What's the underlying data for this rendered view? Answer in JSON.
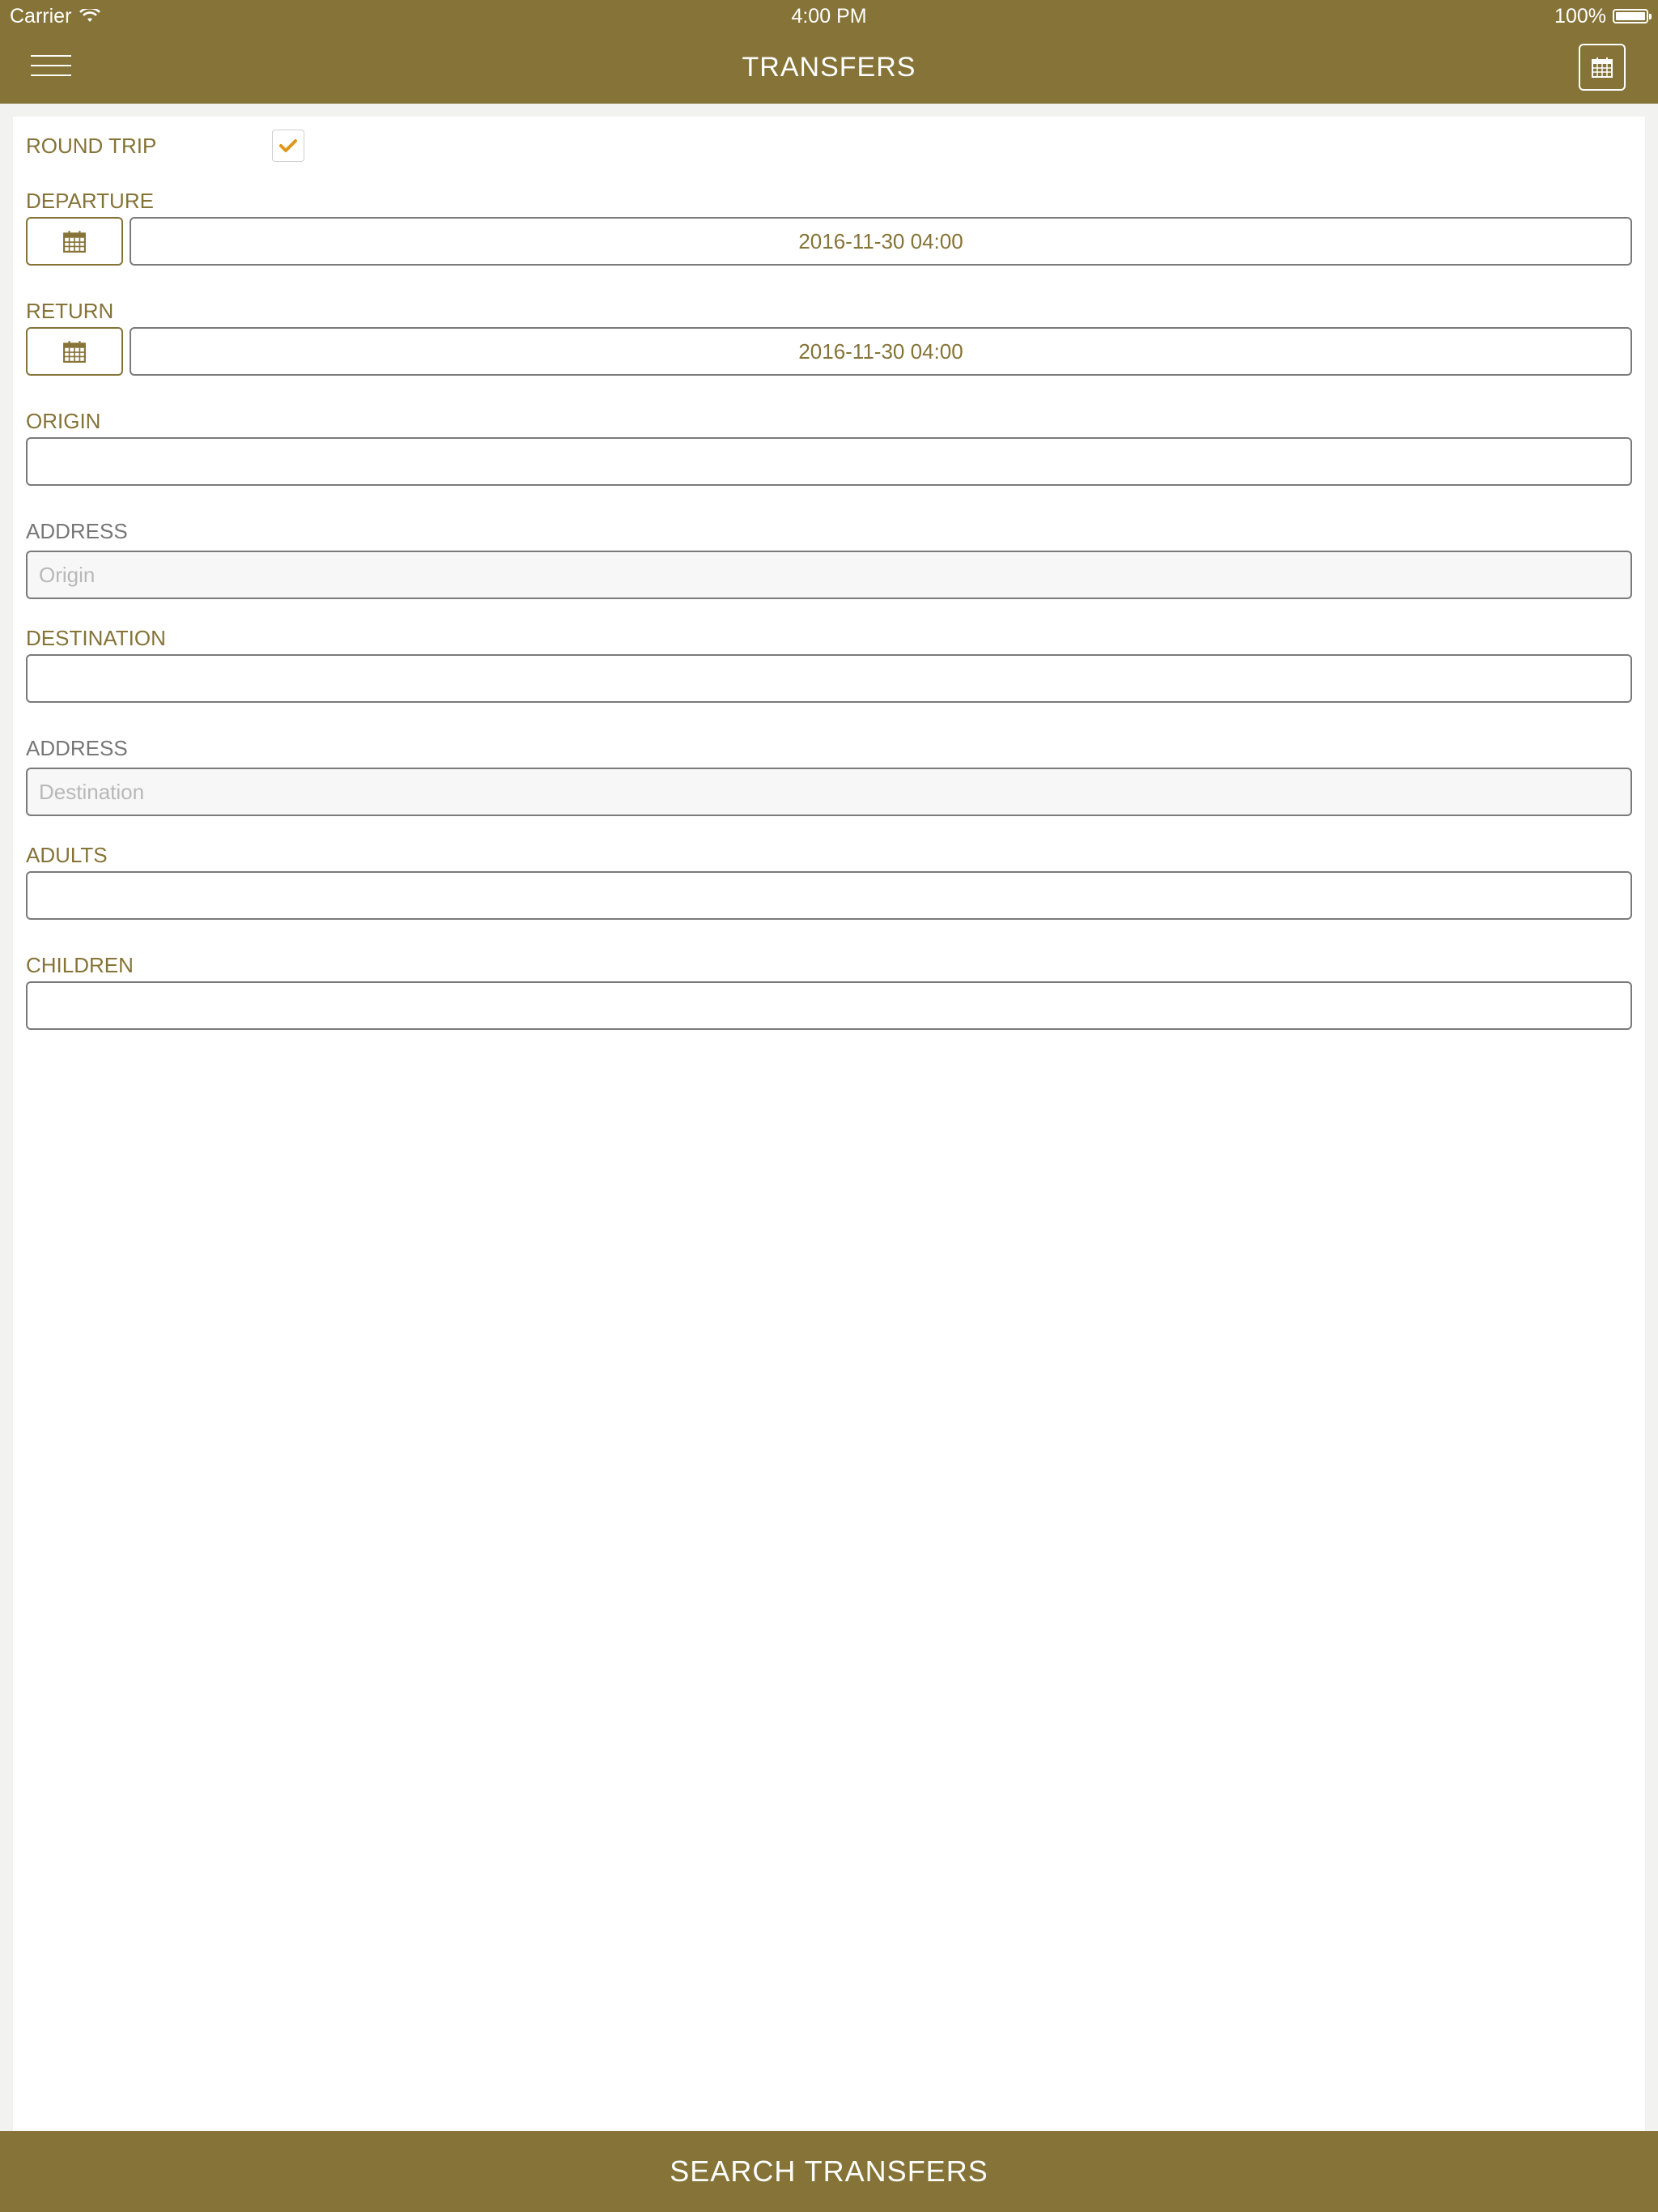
{
  "status_bar": {
    "carrier": "Carrier",
    "time": "4:00 PM",
    "battery": "100%"
  },
  "header": {
    "title": "TRANSFERS",
    "menu_icon": "hamburger-menu-icon",
    "calendar_icon": "calendar-icon"
  },
  "form": {
    "round_trip": {
      "label": "ROUND TRIP",
      "checked": true
    },
    "departure": {
      "label": "DEPARTURE",
      "value": "2016-11-30 04:00"
    },
    "return": {
      "label": "RETURN",
      "value": "2016-11-30 04:00"
    },
    "origin": {
      "label": "ORIGIN",
      "value": ""
    },
    "origin_address": {
      "label": "ADDRESS",
      "placeholder": "Origin"
    },
    "destination": {
      "label": "DESTINATION",
      "value": ""
    },
    "destination_address": {
      "label": "ADDRESS",
      "placeholder": "Destination"
    },
    "adults": {
      "label": "ADULTS",
      "value": ""
    },
    "children": {
      "label": "CHILDREN",
      "value": ""
    }
  },
  "footer": {
    "search_label": "SEARCH TRANSFERS"
  },
  "colors": {
    "brand": "#857337",
    "checkmark": "#e0961c",
    "field_border": "#7a7a7a"
  }
}
